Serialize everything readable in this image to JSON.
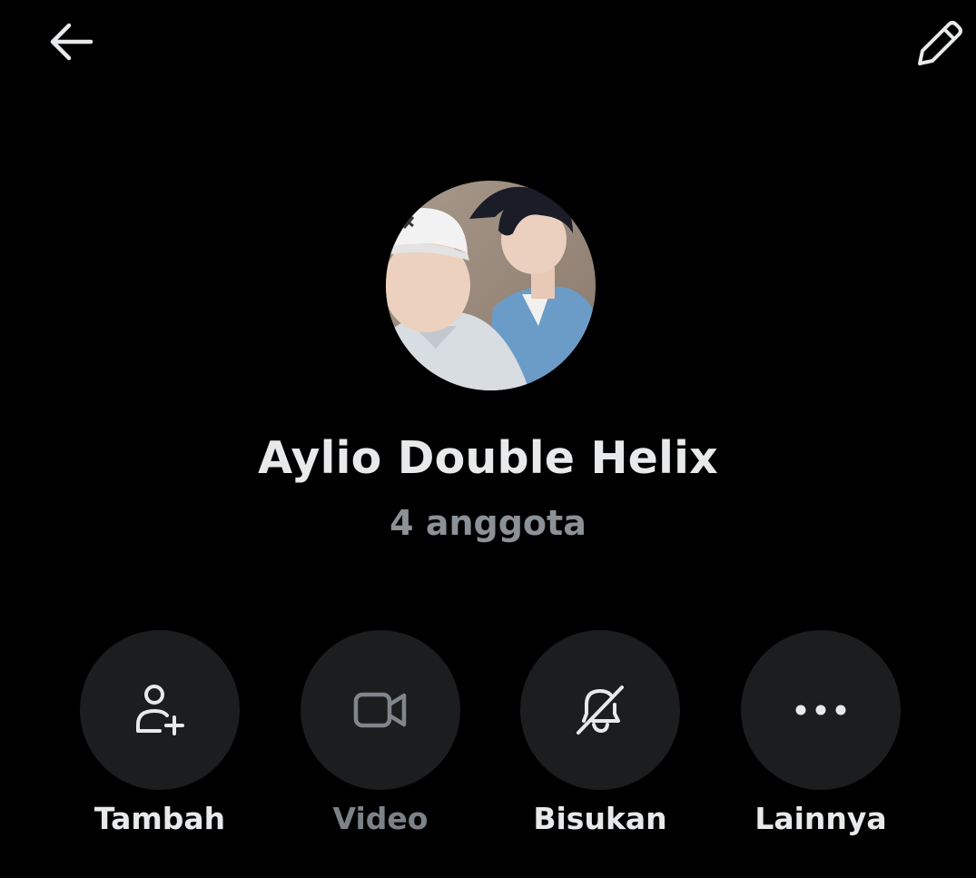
{
  "header": {
    "back_icon": "arrow-left-icon",
    "edit_icon": "pencil-icon"
  },
  "group": {
    "name": "Aylio Double Helix",
    "members": "4 anggota"
  },
  "actions": [
    {
      "label": "Tambah",
      "icon": "add-person-icon",
      "enabled": true
    },
    {
      "label": "Video",
      "icon": "video-camera-icon",
      "enabled": false
    },
    {
      "label": "Bisukan",
      "icon": "bell-off-icon",
      "enabled": true
    },
    {
      "label": "Lainnya",
      "icon": "more-dots-icon",
      "enabled": true
    }
  ],
  "colors": {
    "background": "#000000",
    "text": "#e7e9ea",
    "muted_text": "#8b9197",
    "button_bg": "#1c1d1f"
  }
}
